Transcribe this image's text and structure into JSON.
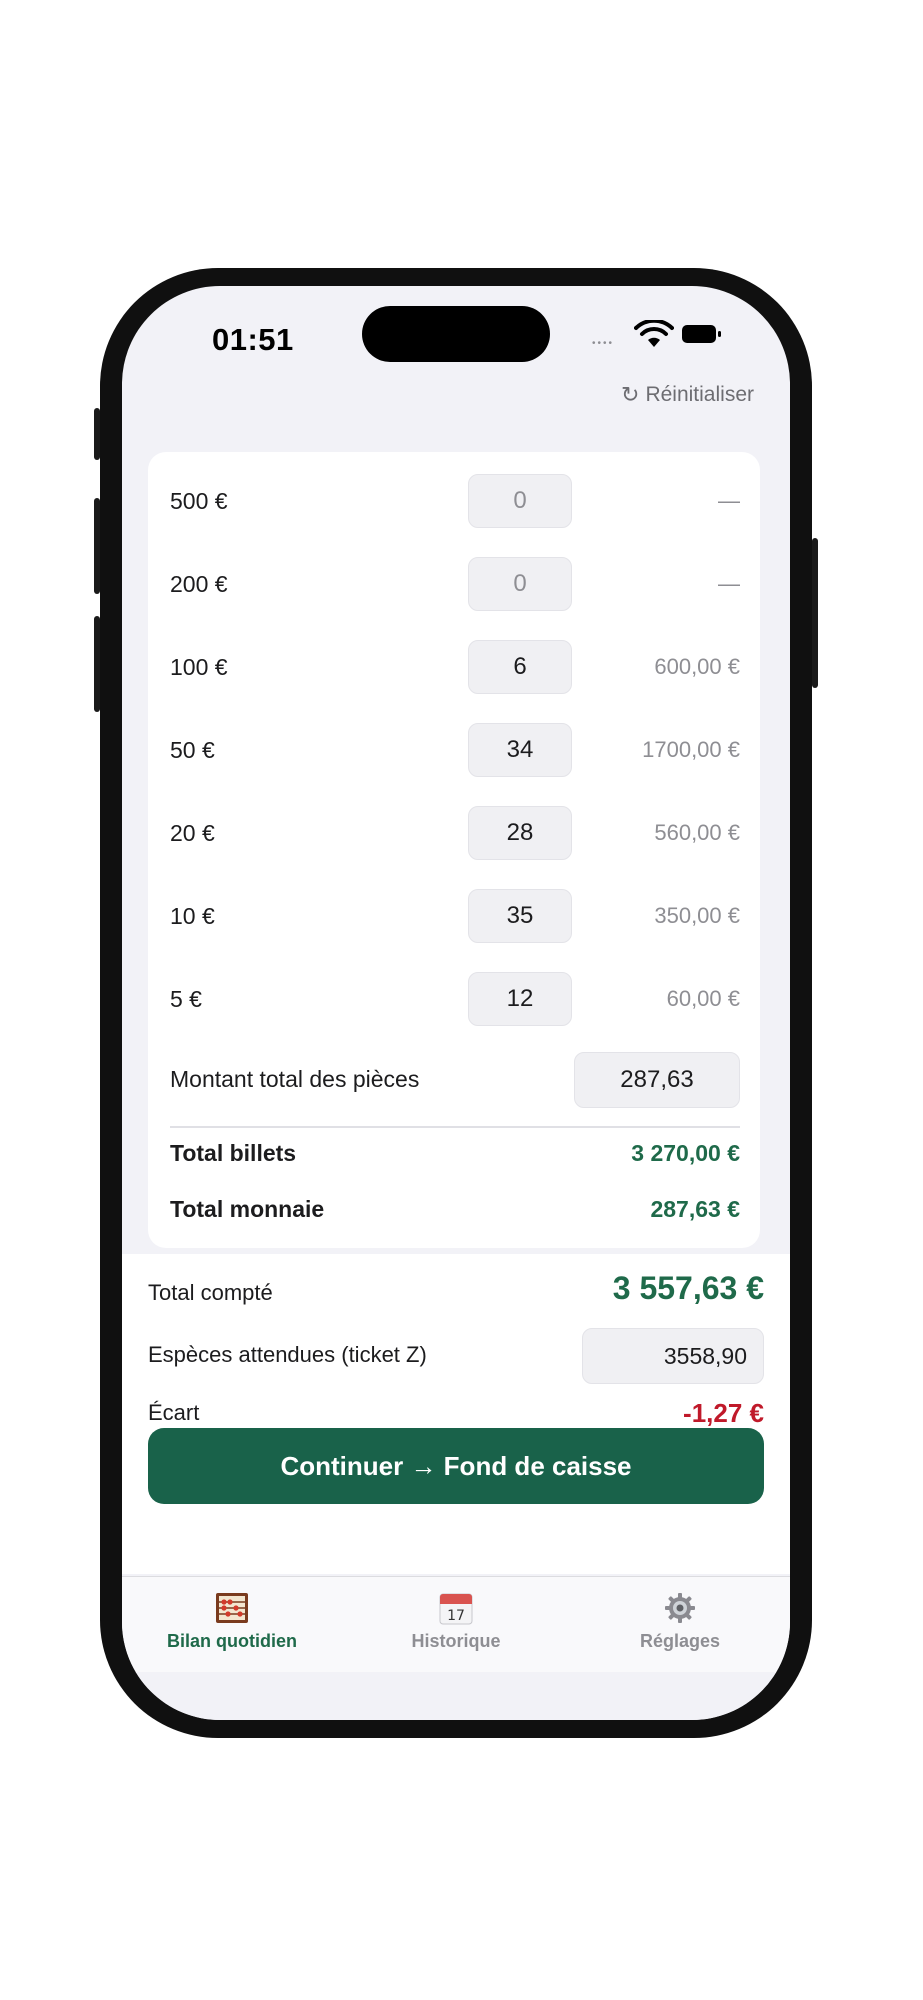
{
  "status_bar": {
    "time": "01:51",
    "signal_dots": "••••"
  },
  "header": {
    "reset_icon": "↻",
    "reset_label": "Réinitialiser"
  },
  "bills": [
    {
      "label": "500 €",
      "qty": "0",
      "amount": "—"
    },
    {
      "label": "200 €",
      "qty": "0",
      "amount": "—"
    },
    {
      "label": "100 €",
      "qty": "6",
      "amount": "600,00 €"
    },
    {
      "label": "50 €",
      "qty": "34",
      "amount": "1700,00 €"
    },
    {
      "label": "20 €",
      "qty": "28",
      "amount": "560,00 €"
    },
    {
      "label": "10 €",
      "qty": "35",
      "amount": "350,00 €"
    },
    {
      "label": "5 €",
      "qty": "12",
      "amount": "60,00 €"
    }
  ],
  "coins": {
    "label": "Montant total des pièces",
    "value": "287,63"
  },
  "totals": {
    "bills_label": "Total billets",
    "bills_value": "3 270,00 €",
    "coins_label": "Total monnaie",
    "coins_value": "287,63 €"
  },
  "summary": {
    "counted_label": "Total compté",
    "counted_value": "3 557,63 €",
    "expected_label": "Espèces attendues (ticket Z)",
    "expected_value": "3558,90",
    "gap_label": "Écart",
    "gap_value": "-1,27 €"
  },
  "cta": {
    "label": "Continuer → Fond de caisse"
  },
  "tabs": [
    {
      "label": "Bilan quotidien",
      "icon": "abacus-icon",
      "active": true
    },
    {
      "label": "Historique",
      "icon": "calendar-icon",
      "active": false,
      "calendar_day": "17"
    },
    {
      "label": "Réglages",
      "icon": "gear-icon",
      "active": false
    }
  ],
  "colors": {
    "accent": "#19624a",
    "accent_text": "#1f6a4a",
    "negative": "#c0192a",
    "muted": "#8e8e93"
  }
}
